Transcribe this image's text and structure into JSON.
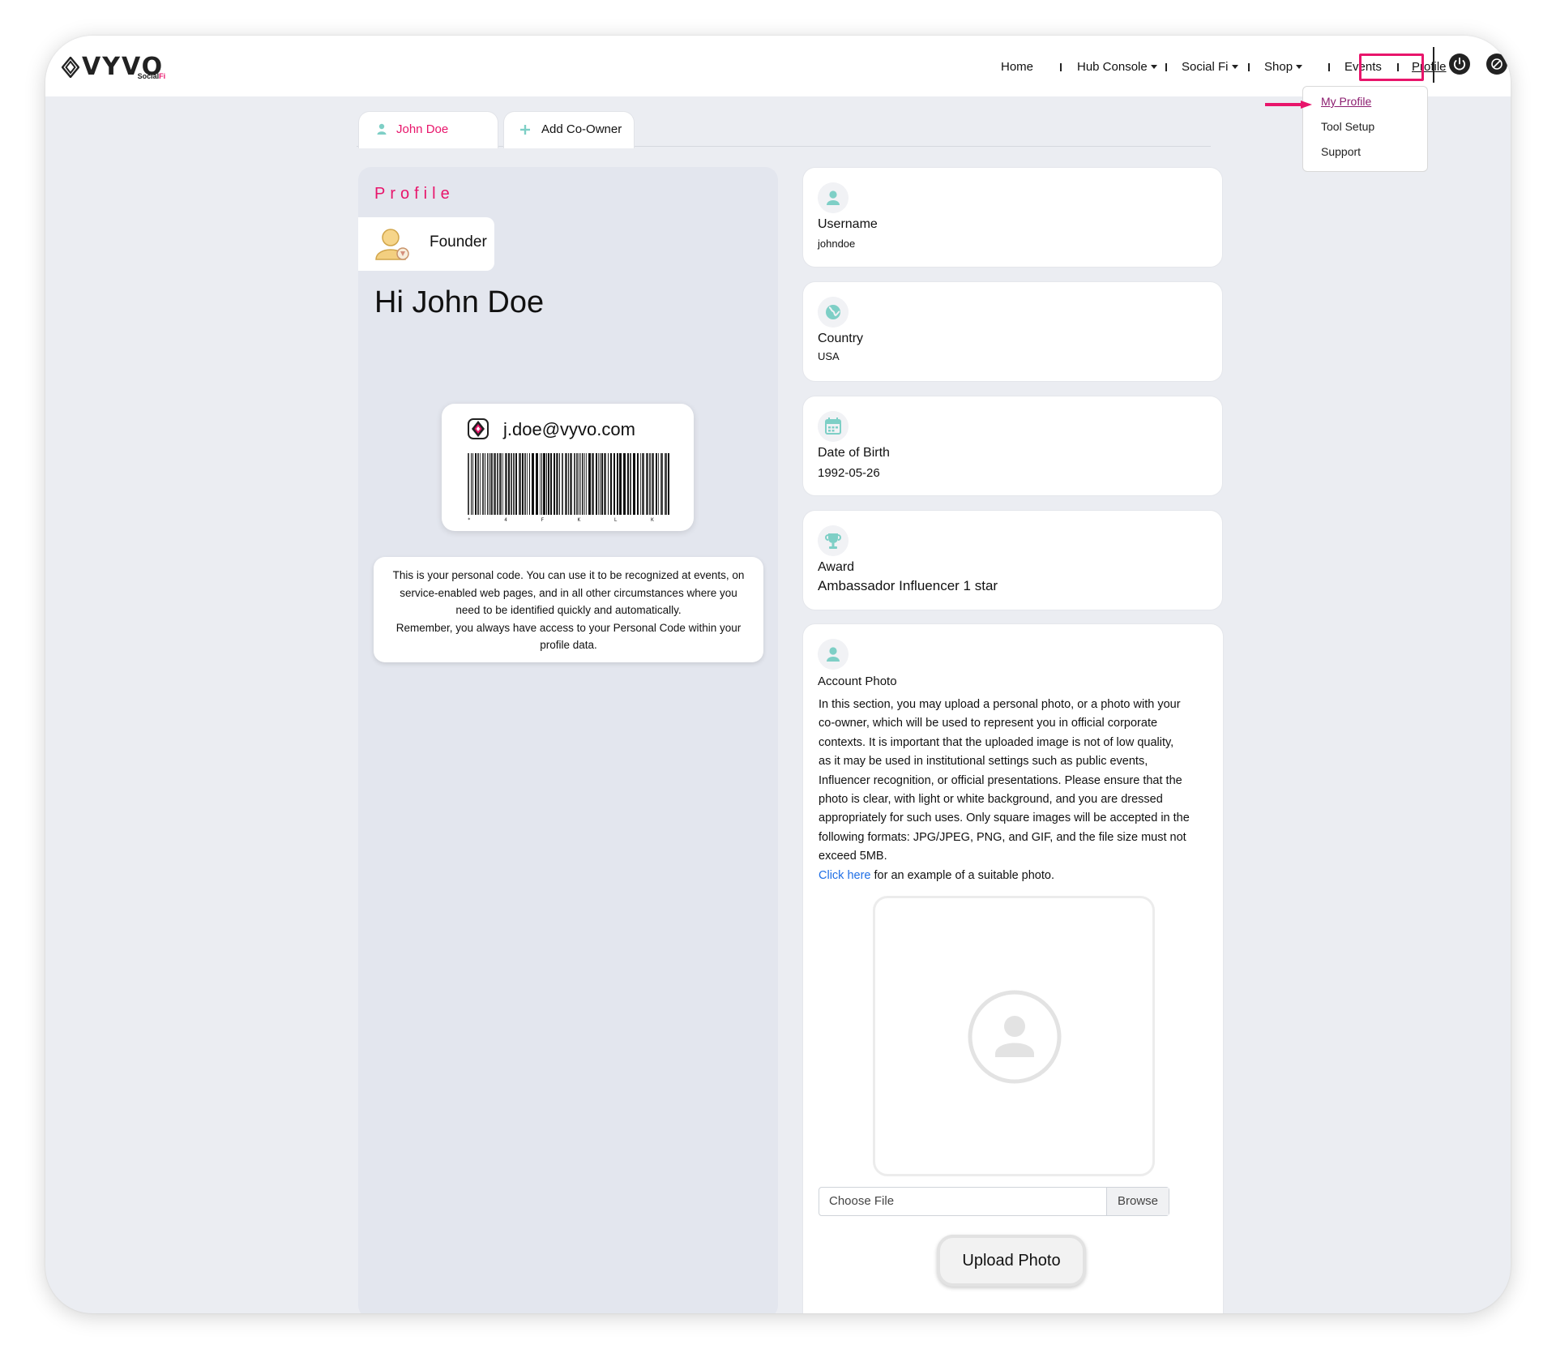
{
  "brand": {
    "name": "VYVO",
    "sub_a": "Social",
    "sub_b": "Fi"
  },
  "nav": {
    "items": [
      "Home",
      "Hub Console",
      "Social Fi",
      "Shop",
      "Events",
      "Profile"
    ],
    "dropdown": [
      "My Profile",
      "Tool Setup",
      "Support"
    ]
  },
  "tabs": {
    "owner": "John Doe",
    "add": "Add Co-Owner"
  },
  "left": {
    "title": "Profile",
    "role": "Founder",
    "greeting": "Hi John Doe",
    "email": "j.doe@vyvo.com",
    "barcode_text": "* 4 F K L K 0 *",
    "info_lines": [
      "This is your personal code. You can use it to be recognized at events, on",
      "service-enabled web pages, and in all other circumstances where you",
      "need to be identified quickly and automatically.",
      "Remember, you always have access to your Personal Code within your",
      "profile data."
    ]
  },
  "cards": {
    "username": {
      "label": "Username",
      "value": "johndoe"
    },
    "country": {
      "label": "Country",
      "value": "USA"
    },
    "dob": {
      "label": "Date of Birth",
      "value": "1992-05-26"
    },
    "award": {
      "label": "Award",
      "value": "Ambassador Influencer 1 star"
    }
  },
  "photo": {
    "label": "Account Photo",
    "desc_lines": [
      "In this section, you may upload a personal photo, or a photo with your",
      "co-owner, which will be used to represent you in official corporate",
      "contexts. It is important that the uploaded image is not of low quality,",
      "as it may be used in institutional settings such as public events,",
      "Influencer recognition, or official presentations. Please ensure that the",
      "photo is clear, with light or white background, and you are dressed",
      "appropriately for such uses. Only square images will be accepted in the",
      "following formats: JPG/JPEG, PNG, and GIF, and the file size must not",
      "exceed 5MB."
    ],
    "link_text": "Click here",
    "link_suffix": " for an example of a suitable photo.",
    "file_placeholder": "Choose File",
    "browse": "Browse",
    "upload": "Upload Photo"
  },
  "colors": {
    "accent": "#e8156b",
    "teal": "#7ecfc6",
    "link": "#1f6fe5"
  }
}
